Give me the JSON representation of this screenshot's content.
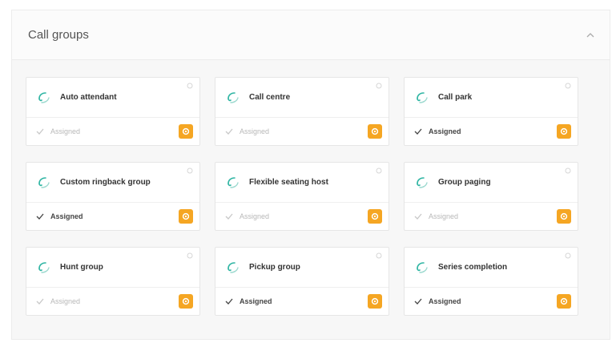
{
  "panel": {
    "title": "Call groups",
    "collapse_icon": "chevron-up-icon"
  },
  "colors": {
    "accent": "#f5a623",
    "icon_teal": "#2fb5a3",
    "muted_text": "#b8b8b8"
  },
  "cards": [
    {
      "name": "Auto attendant",
      "status": "Assigned",
      "assigned": false
    },
    {
      "name": "Call centre",
      "status": "Assigned",
      "assigned": false
    },
    {
      "name": "Call park",
      "status": "Assigned",
      "assigned": true
    },
    {
      "name": "Custom ringback group",
      "status": "Assigned",
      "assigned": true
    },
    {
      "name": "Flexible seating host",
      "status": "Assigned",
      "assigned": false
    },
    {
      "name": "Group paging",
      "status": "Assigned",
      "assigned": false
    },
    {
      "name": "Hunt group",
      "status": "Assigned",
      "assigned": false
    },
    {
      "name": "Pickup group",
      "status": "Assigned",
      "assigned": true
    },
    {
      "name": "Series completion",
      "status": "Assigned",
      "assigned": true
    }
  ]
}
